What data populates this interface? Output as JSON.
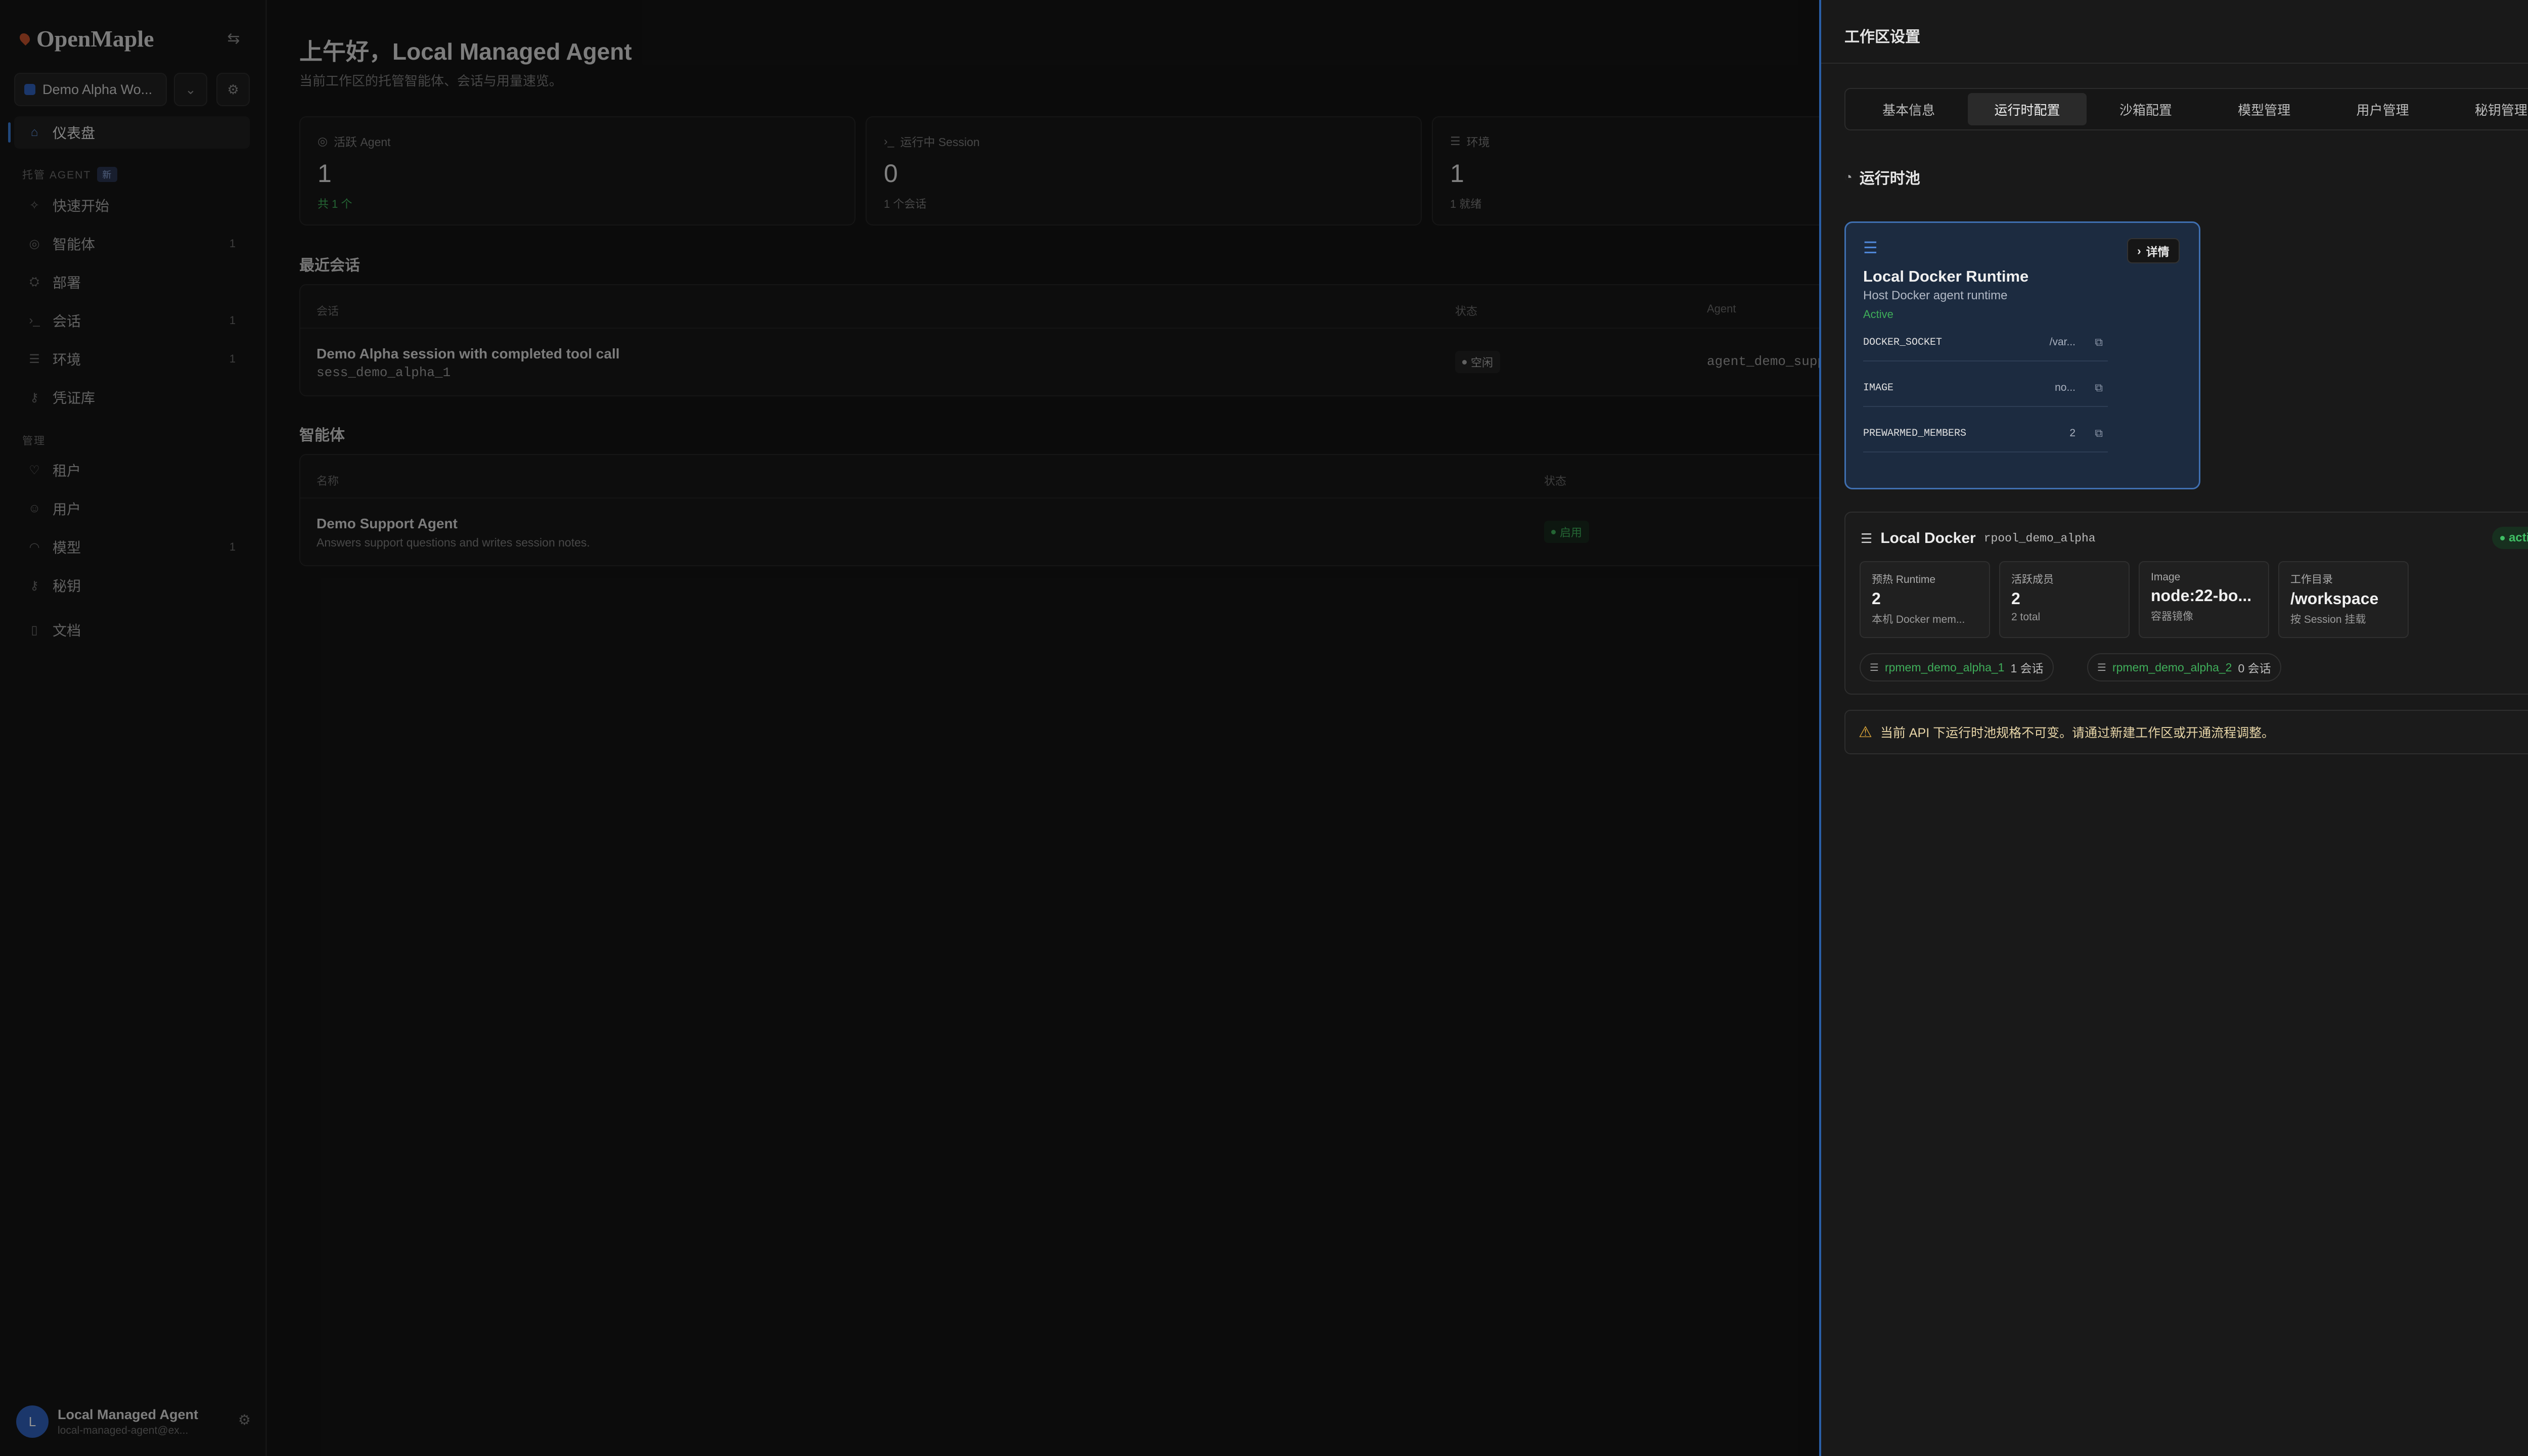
{
  "sidebar": {
    "brand": "OpenMaple",
    "workspace": "Demo Alpha Wo...",
    "items": [
      {
        "label": "仪表盘",
        "icon": "home-icon",
        "count": ""
      },
      {
        "label": "快速开始",
        "icon": "rocket-icon",
        "count": ""
      },
      {
        "label": "智能体",
        "icon": "bot-icon",
        "count": "1"
      },
      {
        "label": "部署",
        "icon": "deploy-icon",
        "count": ""
      },
      {
        "label": "会话",
        "icon": "terminal-icon",
        "count": "1"
      },
      {
        "label": "环境",
        "icon": "server-icon",
        "count": "1"
      },
      {
        "label": "凭证库",
        "icon": "key-icon",
        "count": ""
      },
      {
        "label": "租户",
        "icon": "tenant-icon",
        "count": ""
      },
      {
        "label": "用户",
        "icon": "user-icon",
        "count": ""
      },
      {
        "label": "模型",
        "icon": "model-icon",
        "count": "1"
      },
      {
        "label": "秘钥",
        "icon": "secret-key-icon",
        "count": ""
      },
      {
        "label": "文档",
        "icon": "book-icon",
        "count": ""
      }
    ],
    "section_managed": "托管 AGENT",
    "section_managed_tag": "新",
    "section_admin": "管理",
    "user": {
      "initial": "L",
      "name": "Local Managed Agent",
      "email": "local-managed-agent@ex..."
    }
  },
  "main": {
    "greeting": "上午好，Local Managed Agent",
    "subtitle": "当前工作区的托管智能体、会话与用量速览。",
    "stats": [
      {
        "title": "活跃 Agent",
        "value": "1",
        "sub": "共 1 个"
      },
      {
        "title": "运行中 Session",
        "value": "0",
        "sub": "1 个会话"
      },
      {
        "title": "环境",
        "value": "1",
        "sub": "1 就绪"
      }
    ],
    "recent_title": "最近会话",
    "sessions_table": {
      "headers": [
        "会话",
        "状态",
        "Agent"
      ],
      "row": {
        "title": "Demo Alpha session with completed tool call",
        "id": "sess_demo_alpha_1",
        "status": "空闲",
        "agent": "agent_demo_supp"
      }
    },
    "agents_title": "智能体",
    "agents_table": {
      "headers": [
        "名称",
        "状态"
      ],
      "row": {
        "title": "Demo Support Agent",
        "desc": "Answers support questions and writes session notes.",
        "status": "启用"
      }
    }
  },
  "drawer": {
    "title": "工作区设置",
    "tabs": [
      "基本信息",
      "运行时配置",
      "沙箱配置",
      "模型管理",
      "用户管理",
      "秘钥管理"
    ],
    "active_tab": "运行时配置",
    "pool_title": "运行时池",
    "runtime": {
      "detail_label": "详情",
      "name": "Local Docker Runtime",
      "desc": "Host Docker agent runtime",
      "status": "Active",
      "kv": [
        {
          "k": "DOCKER_SOCKET",
          "v": "/var..."
        },
        {
          "k": "IMAGE",
          "v": "no..."
        },
        {
          "k": "PREWARMED_MEMBERS",
          "v": "2"
        }
      ]
    },
    "pool": {
      "name": "Local Docker",
      "id": "rpool_demo_alpha",
      "badge": "active",
      "metrics": [
        {
          "label": "预热 Runtime",
          "value": "2",
          "sub": "本机 Docker mem..."
        },
        {
          "label": "活跃成员",
          "value": "2",
          "sub": "2 total"
        },
        {
          "label": "Image",
          "value": "node:22-bo...",
          "sub": "容器镜像"
        },
        {
          "label": "工作目录",
          "value": "/workspace",
          "sub": "按 Session 挂载"
        }
      ],
      "members": [
        {
          "id": "rpmem_demo_alpha_1",
          "count": "1 会话"
        },
        {
          "id": "rpmem_demo_alpha_2",
          "count": "0 会话"
        }
      ]
    },
    "warning": "当前 API 下运行时池规格不可变。请通过新建工作区或开通流程调整。"
  },
  "colors": {
    "accent": "#3a7bd5",
    "success": "#3fae5a",
    "warning": "#e0a93a"
  }
}
